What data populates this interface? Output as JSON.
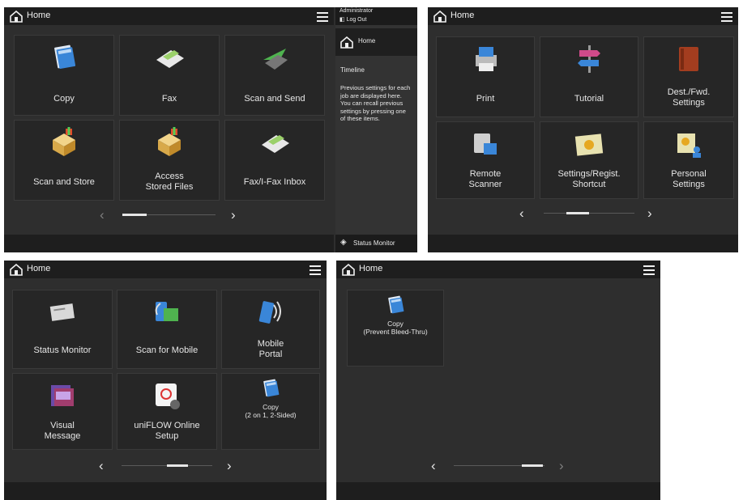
{
  "screens": [
    {
      "title": "Home",
      "tiles": [
        {
          "label": "Copy",
          "icon": "copy-icon"
        },
        {
          "label": "Fax",
          "icon": "fax-icon"
        },
        {
          "label": "Scan and Send",
          "icon": "scan-and-send-icon"
        },
        {
          "label": "Scan and Store",
          "icon": "scan-and-store-icon"
        },
        {
          "label": "Access\nStored Files",
          "icon": "access-stored-files-icon"
        },
        {
          "label": "Fax/I-Fax Inbox",
          "icon": "fax-inbox-icon"
        }
      ],
      "side": {
        "user": "Administrator",
        "logout": "Log Out",
        "home": "Home",
        "timeline_title": "Timeline",
        "timeline_text": "Previous settings for each job are displayed here. You can recall previous settings by pressing one of these items.",
        "status_monitor": "Status Monitor"
      }
    },
    {
      "title": "Home",
      "tiles": [
        {
          "label": "Print",
          "icon": "print-icon"
        },
        {
          "label": "Tutorial",
          "icon": "tutorial-signpost-icon"
        },
        {
          "label": "Dest./Fwd.\nSettings",
          "icon": "address-book-icon"
        },
        {
          "label": "Remote\nScanner",
          "icon": "remote-scanner-icon"
        },
        {
          "label": "Settings/Regist.\nShortcut",
          "icon": "settings-shortcut-icon"
        },
        {
          "label": "Personal\nSettings",
          "icon": "personal-settings-icon"
        }
      ]
    },
    {
      "title": "Home",
      "tiles": [
        {
          "label": "Status Monitor",
          "icon": "status-monitor-icon"
        },
        {
          "label": "Scan for Mobile",
          "icon": "scan-for-mobile-icon"
        },
        {
          "label": "Mobile\nPortal",
          "icon": "mobile-portal-icon"
        },
        {
          "label": "Visual\nMessage",
          "icon": "visual-message-icon"
        },
        {
          "label": "uniFLOW Online\nSetup",
          "icon": "uniflow-setup-icon"
        },
        {
          "label": "Copy\n(2 on 1, 2-Sided)",
          "icon": "copy-2on1-icon"
        }
      ]
    },
    {
      "title": "Home",
      "tiles": [
        {
          "label": "Copy\n(Prevent Bleed-Thru)",
          "icon": "copy-prevent-bleed-icon"
        }
      ]
    }
  ],
  "nav": {
    "prev": "‹",
    "next": "›"
  },
  "colors": {
    "background": "#2e2e2e",
    "header": "#1e1e1e",
    "tile": "#262626",
    "text": "#e6e6e6"
  }
}
